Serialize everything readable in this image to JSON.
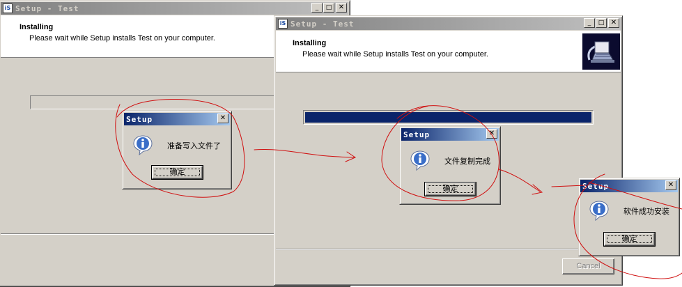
{
  "windows": {
    "setup1": {
      "icon_text": "iS",
      "title": "Setup - Test",
      "header_title": "Installing",
      "header_subtitle": "Please wait while Setup installs Test on your computer."
    },
    "setup2": {
      "icon_text": "iS",
      "title": "Setup - Test",
      "header_title": "Installing",
      "header_subtitle": "Please wait while Setup installs Test on your computer.",
      "progress": 1.0,
      "cancel_label": "Cancel"
    }
  },
  "titlebar_buttons": {
    "minimize": "_",
    "maximize": "□",
    "close": "✕"
  },
  "dialogs": [
    {
      "title": "Setup",
      "message": "准备写入文件了",
      "ok_label": "确定"
    },
    {
      "title": "Setup",
      "message": "文件复制完成",
      "ok_label": "确定"
    },
    {
      "title": "Setup",
      "message": "软件成功安装",
      "ok_label": "确定"
    }
  ],
  "colors": {
    "window_face": "#d4d0c8",
    "active_title": "#0a246a",
    "progress_fill": "#0a246a",
    "annotation": "#d01010"
  },
  "icons": [
    "setup-app-icon",
    "info-icon",
    "setup-logo-icon"
  ]
}
